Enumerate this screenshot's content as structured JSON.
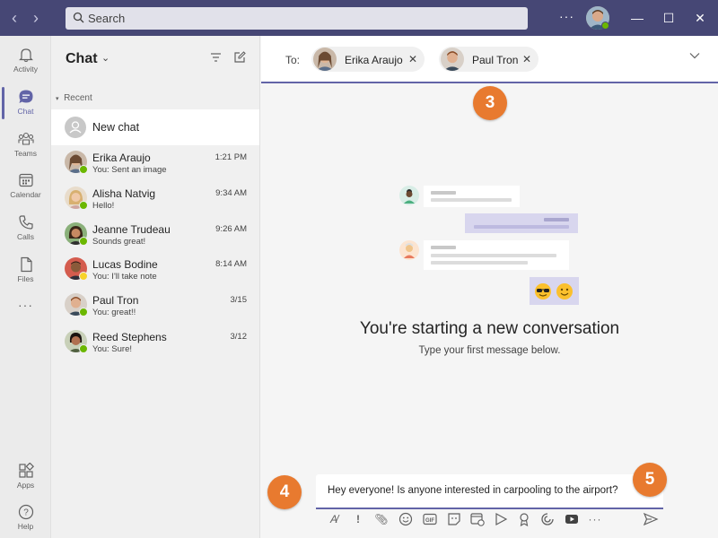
{
  "search": {
    "placeholder": "Search"
  },
  "rail": {
    "items": [
      {
        "label": "Activity",
        "icon": "bell-icon"
      },
      {
        "label": "Chat",
        "icon": "chat-icon"
      },
      {
        "label": "Teams",
        "icon": "teams-icon"
      },
      {
        "label": "Calendar",
        "icon": "calendar-icon"
      },
      {
        "label": "Calls",
        "icon": "phone-icon"
      },
      {
        "label": "Files",
        "icon": "file-icon"
      }
    ],
    "more": "···",
    "apps": "Apps",
    "help": "Help"
  },
  "chatlist": {
    "title": "Chat",
    "recent": "Recent",
    "new_chat": "New chat",
    "rows": [
      {
        "name": "Erika Araujo",
        "preview": "You: Sent an image",
        "time": "1:21 PM"
      },
      {
        "name": "Alisha Natvig",
        "preview": "Hello!",
        "time": "9:34 AM"
      },
      {
        "name": "Jeanne Trudeau",
        "preview": "Sounds great!",
        "time": "9:26 AM"
      },
      {
        "name": "Lucas Bodine",
        "preview": "You: I'll take note",
        "time": "8:14 AM"
      },
      {
        "name": "Paul Tron",
        "preview": "You: great!!",
        "time": "3/15"
      },
      {
        "name": "Reed Stephens",
        "preview": "You: Sure!",
        "time": "3/12"
      }
    ]
  },
  "main": {
    "to_label": "To:",
    "recipients": [
      {
        "name": "Erika Araujo"
      },
      {
        "name": "Paul Tron"
      }
    ],
    "empty_title": "You're starting a new conversation",
    "empty_sub": "Type your first message below.",
    "message": "Hey everyone! Is anyone interested in carpooling to the airport?"
  },
  "callouts": {
    "c3": "3",
    "c4": "4",
    "c5": "5"
  },
  "colors": {
    "accent": "#6264a7",
    "titlebar": "#464775",
    "callout": "#e87a2f"
  }
}
